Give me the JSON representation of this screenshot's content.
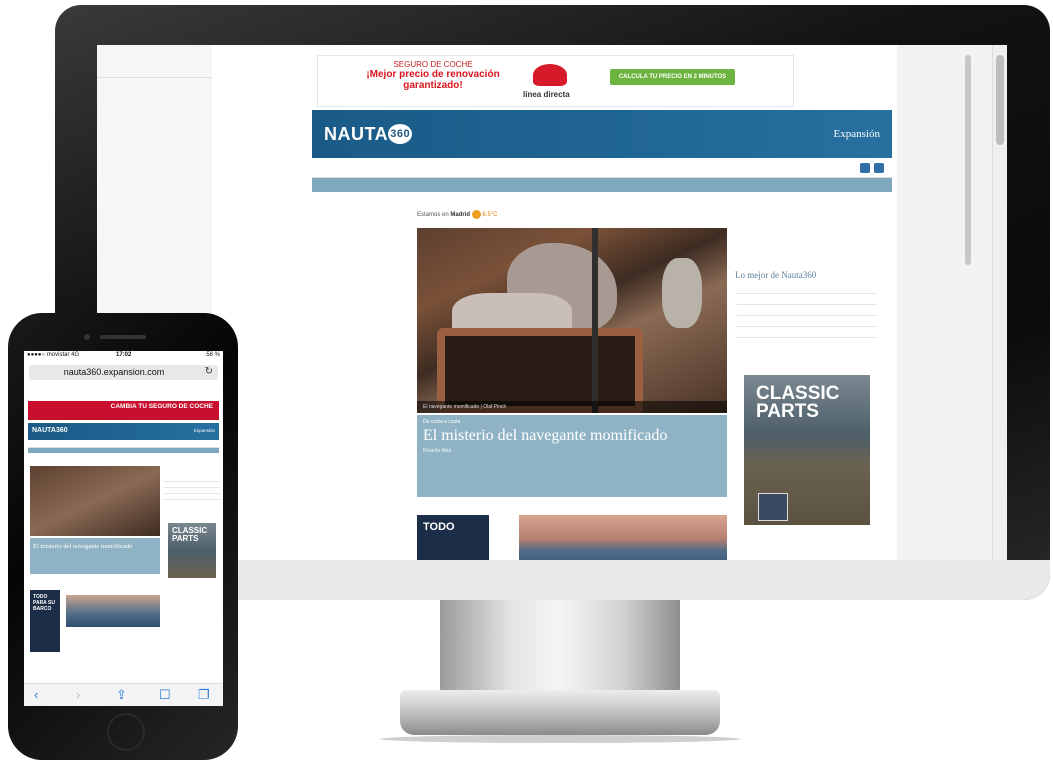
{
  "desktop": {
    "ad": {
      "line1": "SEGURO DE COCHE",
      "headline": "¡Mejor precio de renovación garantizado!",
      "brand": "línea directa",
      "cta": "CALCULA TU PRECIO EN 2 MINUTOS"
    },
    "brand": {
      "logo_text": "NAUTA",
      "logo_num": "360",
      "publisher": "Expansión"
    },
    "weather": {
      "prefix": "Estamos en",
      "city": "Madrid",
      "temp": "6.5°C"
    },
    "hero_caption": "El navegante momificado | Olaf Pinch",
    "article": {
      "kicker": "De costa a costa",
      "headline": "El misterio del navegante momificado",
      "author": "Ricardo Mas"
    },
    "promo_text": "TODO",
    "sidebar_title": "Lo mejor de Nauta360",
    "magazine_title": "CLASSIC PARTS"
  },
  "phone": {
    "status": {
      "carrier": "●●●●○ movistar  4G",
      "time": "17:02",
      "battery": "58 %"
    },
    "url": "nauta360.expansion.com",
    "reload_icon": "↻",
    "ad_text": "CAMBIA TU SEGURO DE COCHE",
    "brand_logo": "NAUTA360",
    "brand_publisher": "Expansión",
    "article_headline": "El misterio del navegante momificado",
    "magazine_title": "CLASSIC PARTS",
    "promo_text": "TODO PARA SU BARCO",
    "toolbar": {
      "back": "‹",
      "forward": "›",
      "share": "⇪",
      "bookmarks": "☐",
      "tabs": "❐"
    }
  }
}
